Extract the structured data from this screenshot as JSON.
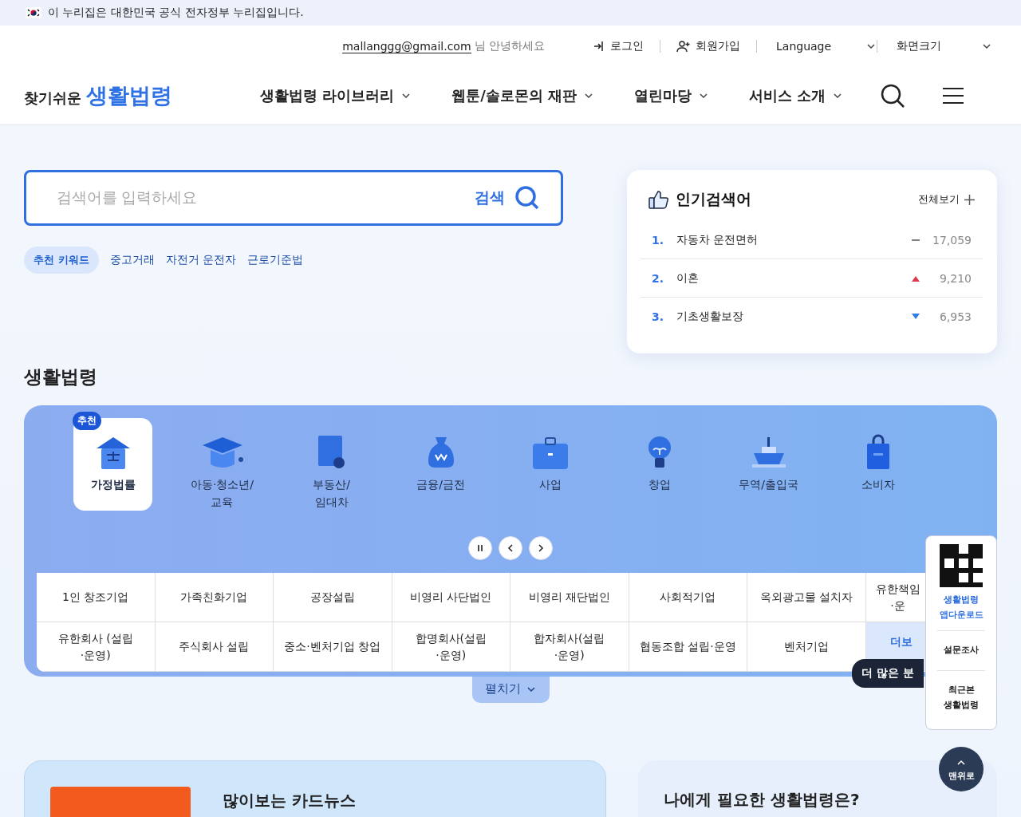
{
  "gov_banner": {
    "text": "이 누리집은 대한민국 공식 전자정부 누리집입니다."
  },
  "utility": {
    "user_email": "mallanggg@gmail.com",
    "greeting": "님 안녕하세요",
    "links": [
      "로그인",
      "회원가입"
    ],
    "selects": [
      "Language",
      "화면크기"
    ]
  },
  "logo": {
    "small": "찾기쉬운",
    "large": "생활법령"
  },
  "nav": [
    "생활법령 라이브러리",
    "웹툰/솔로몬의 재판",
    "열린마당",
    "서비스 소개"
  ],
  "search": {
    "placeholder": "검색어를 입력하세요",
    "button": "검색"
  },
  "keywords": {
    "label": "추천 키워드",
    "items": [
      "중고거래",
      "자전거 운전자",
      "근로기준법"
    ]
  },
  "popular": {
    "title": "인기검색어",
    "more": "전체보기",
    "items": [
      {
        "rank": "1.",
        "term": "자동차 운전면허",
        "rising": false,
        "falling": false,
        "count": "17,059"
      },
      {
        "rank": "2.",
        "term": "이혼",
        "rising": true,
        "falling": false,
        "count": "9,210"
      },
      {
        "rank": "3.",
        "term": "기초생활보장",
        "rising": false,
        "falling": true,
        "count": "6,953"
      }
    ]
  },
  "section_title": "생활법령",
  "categories": [
    {
      "label": "가정법률",
      "selected": true,
      "badge": "추천"
    },
    {
      "label": "아동·청소년/\n교육",
      "selected": false
    },
    {
      "label": "부동산/\n임대차",
      "selected": false
    },
    {
      "label": "금융/금전",
      "selected": false
    },
    {
      "label": "사업",
      "selected": false
    },
    {
      "label": "창업",
      "selected": false
    },
    {
      "label": "무역/출입국",
      "selected": false
    },
    {
      "label": "소비자",
      "selected": false
    }
  ],
  "table_rows": [
    [
      {
        "text": "1인 창조기업",
        "kind": "item"
      },
      {
        "text": "가족친화기업",
        "kind": "item"
      },
      {
        "text": "공장설립",
        "kind": "item"
      },
      {
        "text": "비영리 사단법인",
        "kind": "item"
      },
      {
        "text": "비영리 재단법인",
        "kind": "item"
      },
      {
        "text": "사회적기업",
        "kind": "item"
      },
      {
        "text": "옥외광고물 설치자",
        "kind": "item"
      },
      {
        "text": "유한책임\n·운",
        "kind": "cut"
      }
    ],
    [
      {
        "text": "유한회사 (설립\n·운영)",
        "kind": "item"
      },
      {
        "text": "주식회사 설립",
        "kind": "item"
      },
      {
        "text": "중소·벤처기업 창업",
        "kind": "item"
      },
      {
        "text": "합명회사(설립\n·운영)",
        "kind": "item"
      },
      {
        "text": "합자회사(설립\n·운영)",
        "kind": "item"
      },
      {
        "text": "협동조합 설립·운영",
        "kind": "item"
      },
      {
        "text": "벤처기업",
        "kind": "item"
      },
      {
        "text": "더보",
        "kind": "more"
      }
    ]
  ],
  "tooltip": "더 많은 분",
  "expand_button": "펼치기",
  "side_panel": {
    "app": "생활법령\n앱다운로드",
    "survey": "설문조사",
    "recent": "최근본\n생활법령"
  },
  "top_button": "맨위로",
  "card_news": {
    "title": "많이보는 카드뉴스"
  },
  "need_panel": {
    "title": "나에게 필요한 생활법령은?"
  }
}
